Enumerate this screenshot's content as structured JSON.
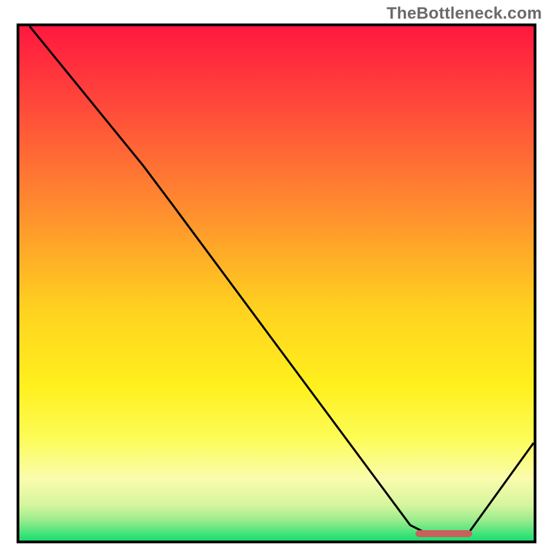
{
  "watermark": "TheBottleneck.com",
  "chart_data": {
    "type": "line",
    "title": "",
    "xlabel": "",
    "ylabel": "",
    "x_range": [
      0,
      100
    ],
    "y_range": [
      0,
      100
    ],
    "background_gradient": {
      "stops": [
        {
          "pct": 0,
          "color": "#ff183f"
        },
        {
          "pct": 16,
          "color": "#ff4b3a"
        },
        {
          "pct": 35,
          "color": "#ff8b2f"
        },
        {
          "pct": 55,
          "color": "#ffd21f"
        },
        {
          "pct": 70,
          "color": "#fff01e"
        },
        {
          "pct": 80,
          "color": "#fcfc56"
        },
        {
          "pct": 88,
          "color": "#fafcad"
        },
        {
          "pct": 93,
          "color": "#d6f59e"
        },
        {
          "pct": 96,
          "color": "#9bec8e"
        },
        {
          "pct": 100,
          "color": "#18de6f"
        }
      ]
    },
    "series": [
      {
        "name": "bottleneck-curve",
        "stroke": "#000000",
        "stroke_width": 3,
        "points": [
          {
            "x": 2,
            "y": 100
          },
          {
            "x": 24,
            "y": 73
          },
          {
            "x": 30,
            "y": 65
          },
          {
            "x": 76,
            "y": 3
          },
          {
            "x": 80,
            "y": 1
          },
          {
            "x": 87,
            "y": 1
          },
          {
            "x": 100,
            "y": 19
          }
        ]
      }
    ],
    "marker": {
      "name": "optimal-range",
      "x_start": 77,
      "x_end": 88,
      "y": 1.3,
      "color": "#c9605e"
    }
  }
}
